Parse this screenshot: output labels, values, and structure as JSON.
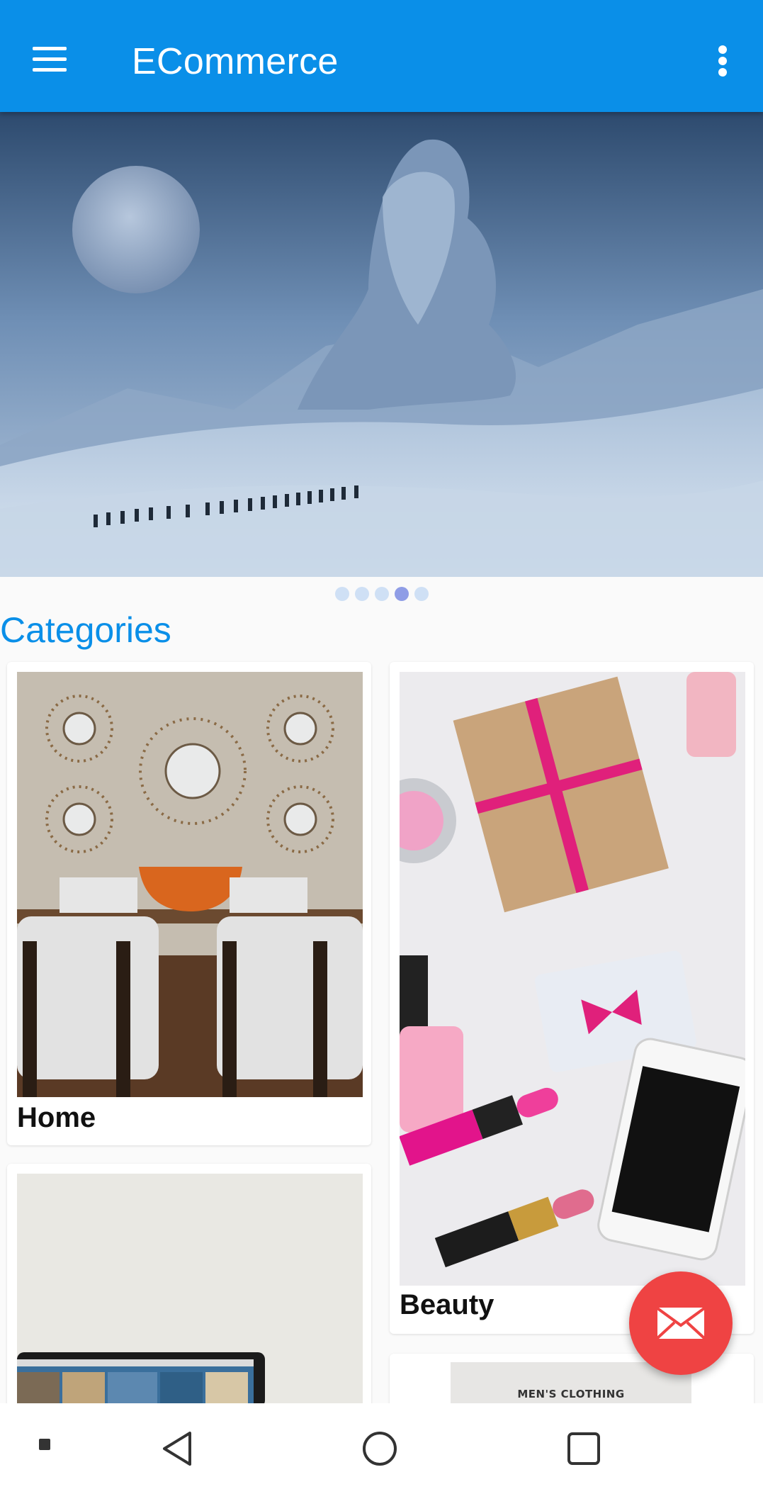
{
  "appbar": {
    "title": "ECommerce",
    "menu_icon": "hamburger-menu-icon",
    "overflow_icon": "more-vert-icon",
    "color": "#0a8fe8"
  },
  "banner": {
    "image": "snowy-mountain-giant-statue-hikers",
    "slide_count": 5,
    "active_slide": 4
  },
  "categories": {
    "heading": "Categories",
    "items": [
      {
        "label": "Home",
        "image": "living-room-mirrors-chairs"
      },
      {
        "label": "Beauty",
        "image": "cosmetics-gift-box-phone"
      },
      {
        "label": "",
        "image": "laptop-desk"
      },
      {
        "label": "",
        "image": "mens-clothing",
        "image_text": "MEN'S CLOTHING"
      }
    ]
  },
  "fab": {
    "icon": "mail-icon",
    "color": "#ef4343"
  },
  "navbar": {
    "icons": [
      "square-small-icon",
      "back-triangle-icon",
      "home-circle-icon",
      "recents-square-icon"
    ]
  }
}
